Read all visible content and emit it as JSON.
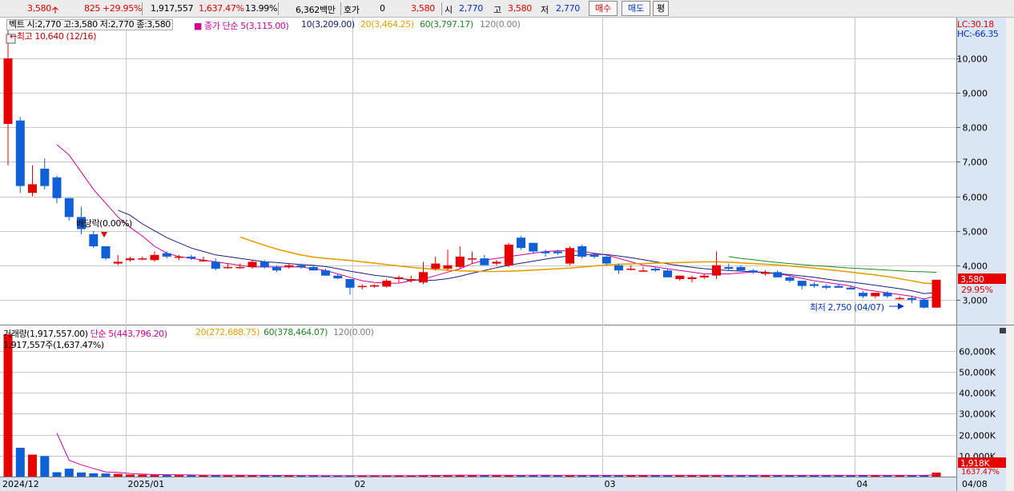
{
  "toolbar": {
    "price": "3,580",
    "change": "825",
    "change_pct": "+29.95%",
    "volume": "1,917,557",
    "volume_pct": "1,637.47%",
    "turnover": "13.99%",
    "amount": "6,362백만",
    "quote_label": "호가",
    "quote_value": "0",
    "quote_price": "3,580",
    "open_label": "시",
    "open": "2,770",
    "high_label": "고",
    "high": "3,580",
    "low_label": "저",
    "low": "2,770",
    "buy_label": "매수",
    "sell_label": "매도",
    "avg_label": "평"
  },
  "colors": {
    "up": "#e60000",
    "down": "#0f5fd6",
    "ma5": "#d1009a",
    "ma10": "#18207f",
    "ma20": "#e8a000",
    "ma60": "#1e8a1e",
    "panel_bg": "#dbe6f4",
    "grid": "#c8c8c8"
  },
  "price_legend": {
    "vtext": "벡트 시:2,770 고:3,580 저:2,770 종:3,580",
    "ma_title": "종가 단순",
    "ma5": "5(3,115.00)",
    "ma10": "10(3,209.00)",
    "ma20": "20(3,464.25)",
    "ma60": "60(3,797.17)",
    "ma120": "120(0.00)"
  },
  "volume_legend": {
    "title": "거래량(1,917,557.00)",
    "ma_title": "단순",
    "ma5": "5(443,796.20)",
    "ma20": "20(272,688.75)",
    "ma60": "60(378,464.07)",
    "ma120": "120(0.00)",
    "sub": "1,917,557주(1,637.47%)"
  },
  "annotations": {
    "high_marker": "←최고 10,640 (12/16)",
    "low_marker": "최저 2,750 (04/07)",
    "dividend": "배당락(0.00%)",
    "lc": "LC:30.18",
    "hc": "HC:-66.35",
    "price_tag": "3,580",
    "pct_tag": "29.95%",
    "vol_tag": "1,918K",
    "vol_pct_tag": "1637.47%"
  },
  "chart_data": [
    {
      "type": "candlestick",
      "title": "",
      "x_labels": [
        "2024/12",
        "2025/01",
        "02",
        "03",
        "04",
        "04/08"
      ],
      "y_ticks": [
        3000,
        4000,
        5000,
        6000,
        7000,
        8000,
        9000,
        10000
      ],
      "ylim": [
        2300,
        11000
      ],
      "grid": true,
      "candles": [
        {
          "open": 8100,
          "high": 11000,
          "low": 6900,
          "close": 10000
        },
        {
          "open": 8200,
          "high": 8300,
          "low": 6100,
          "close": 6300
        },
        {
          "open": 6100,
          "high": 6900,
          "low": 6000,
          "close": 6350
        },
        {
          "open": 6800,
          "high": 7100,
          "low": 6200,
          "close": 6300
        },
        {
          "open": 6550,
          "high": 6600,
          "low": 5800,
          "close": 5950
        },
        {
          "open": 5950,
          "high": 5950,
          "low": 5300,
          "close": 5400
        },
        {
          "open": 5400,
          "high": 5700,
          "low": 4900,
          "close": 5050
        },
        {
          "open": 4900,
          "high": 5000,
          "low": 4500,
          "close": 4550
        },
        {
          "open": 4550,
          "high": 4550,
          "low": 4150,
          "close": 4200
        },
        {
          "open": 4050,
          "high": 4300,
          "low": 4000,
          "close": 4100
        },
        {
          "open": 4150,
          "high": 4250,
          "low": 4100,
          "close": 4200
        },
        {
          "open": 4200,
          "high": 4250,
          "low": 4150,
          "close": 4200
        },
        {
          "open": 4150,
          "high": 4400,
          "low": 4100,
          "close": 4300
        },
        {
          "open": 4350,
          "high": 4400,
          "low": 4200,
          "close": 4250
        },
        {
          "open": 4250,
          "high": 4300,
          "low": 4150,
          "close": 4250
        },
        {
          "open": 4250,
          "high": 4300,
          "low": 4150,
          "close": 4200
        },
        {
          "open": 4150,
          "high": 4250,
          "low": 4100,
          "close": 4150
        },
        {
          "open": 4100,
          "high": 4200,
          "low": 3850,
          "close": 3900
        },
        {
          "open": 3950,
          "high": 4050,
          "low": 3900,
          "close": 3950
        },
        {
          "open": 3950,
          "high": 4050,
          "low": 3900,
          "close": 3950
        },
        {
          "open": 3950,
          "high": 4150,
          "low": 3900,
          "close": 4100
        },
        {
          "open": 4100,
          "high": 4150,
          "low": 3900,
          "close": 3950
        },
        {
          "open": 3950,
          "high": 4000,
          "low": 3800,
          "close": 3850
        },
        {
          "open": 3950,
          "high": 4050,
          "low": 3900,
          "close": 4000
        },
        {
          "open": 4000,
          "high": 4050,
          "low": 3900,
          "close": 3950
        },
        {
          "open": 3950,
          "high": 4000,
          "low": 3850,
          "close": 3850
        },
        {
          "open": 3850,
          "high": 3900,
          "low": 3700,
          "close": 3700
        },
        {
          "open": 3700,
          "high": 3750,
          "low": 3600,
          "close": 3620
        },
        {
          "open": 3600,
          "high": 3600,
          "low": 3150,
          "close": 3350
        },
        {
          "open": 3370,
          "high": 3450,
          "low": 3300,
          "close": 3400
        },
        {
          "open": 3380,
          "high": 3450,
          "low": 3350,
          "close": 3420
        },
        {
          "open": 3380,
          "high": 3600,
          "low": 3350,
          "close": 3550
        },
        {
          "open": 3600,
          "high": 3700,
          "low": 3500,
          "close": 3650
        },
        {
          "open": 3550,
          "high": 3700,
          "low": 3500,
          "close": 3600
        },
        {
          "open": 3500,
          "high": 4100,
          "low": 3450,
          "close": 3800
        },
        {
          "open": 3900,
          "high": 4250,
          "low": 3850,
          "close": 4050
        },
        {
          "open": 3900,
          "high": 4450,
          "low": 3850,
          "close": 4000
        },
        {
          "open": 3950,
          "high": 4550,
          "low": 3900,
          "close": 4250
        },
        {
          "open": 4200,
          "high": 4400,
          "low": 4050,
          "close": 4200
        },
        {
          "open": 4200,
          "high": 4300,
          "low": 4000,
          "close": 4000
        },
        {
          "open": 4050,
          "high": 4150,
          "low": 4000,
          "close": 4100
        },
        {
          "open": 4000,
          "high": 4650,
          "low": 3950,
          "close": 4600
        },
        {
          "open": 4800,
          "high": 4850,
          "low": 4450,
          "close": 4500
        },
        {
          "open": 4650,
          "high": 4650,
          "low": 4350,
          "close": 4400
        },
        {
          "open": 4400,
          "high": 4450,
          "low": 4250,
          "close": 4350
        },
        {
          "open": 4400,
          "high": 4450,
          "low": 4300,
          "close": 4350
        },
        {
          "open": 4050,
          "high": 4550,
          "low": 4000,
          "close": 4500
        },
        {
          "open": 4550,
          "high": 4600,
          "low": 4200,
          "close": 4250
        },
        {
          "open": 4300,
          "high": 4350,
          "low": 4200,
          "close": 4250
        },
        {
          "open": 4250,
          "high": 4300,
          "low": 4000,
          "close": 4050
        },
        {
          "open": 4000,
          "high": 4050,
          "low": 3750,
          "close": 3850
        },
        {
          "open": 3900,
          "high": 4000,
          "low": 3850,
          "close": 3900
        },
        {
          "open": 3850,
          "high": 3950,
          "low": 3800,
          "close": 3850
        },
        {
          "open": 3900,
          "high": 3950,
          "low": 3800,
          "close": 3850
        },
        {
          "open": 3850,
          "high": 3900,
          "low": 3650,
          "close": 3650
        },
        {
          "open": 3600,
          "high": 3700,
          "low": 3550,
          "close": 3700
        },
        {
          "open": 3600,
          "high": 3700,
          "low": 3500,
          "close": 3650
        },
        {
          "open": 3650,
          "high": 3750,
          "low": 3600,
          "close": 3700
        },
        {
          "open": 3700,
          "high": 4400,
          "low": 3600,
          "close": 4000
        },
        {
          "open": 3950,
          "high": 4050,
          "low": 3850,
          "close": 3900
        },
        {
          "open": 3950,
          "high": 4000,
          "low": 3850,
          "close": 3850
        },
        {
          "open": 3850,
          "high": 3900,
          "low": 3750,
          "close": 3800
        },
        {
          "open": 3750,
          "high": 3850,
          "low": 3700,
          "close": 3800
        },
        {
          "open": 3800,
          "high": 3850,
          "low": 3650,
          "close": 3650
        },
        {
          "open": 3650,
          "high": 3700,
          "low": 3500,
          "close": 3550
        },
        {
          "open": 3550,
          "high": 3550,
          "low": 3300,
          "close": 3400
        },
        {
          "open": 3450,
          "high": 3500,
          "low": 3350,
          "close": 3400
        },
        {
          "open": 3400,
          "high": 3450,
          "low": 3300,
          "close": 3350
        },
        {
          "open": 3400,
          "high": 3450,
          "low": 3350,
          "close": 3350
        },
        {
          "open": 3350,
          "high": 3400,
          "low": 3300,
          "close": 3300
        },
        {
          "open": 3200,
          "high": 3250,
          "low": 3050,
          "close": 3100
        },
        {
          "open": 3100,
          "high": 3200,
          "low": 3050,
          "close": 3200
        },
        {
          "open": 3200,
          "high": 3250,
          "low": 3050,
          "close": 3100
        },
        {
          "open": 3050,
          "high": 3100,
          "low": 3000,
          "close": 3050
        },
        {
          "open": 3050,
          "high": 3100,
          "low": 2900,
          "close": 3000
        },
        {
          "open": 3000,
          "high": 3050,
          "low": 2750,
          "close": 2770
        },
        {
          "open": 2770,
          "high": 3580,
          "low": 2770,
          "close": 3580
        }
      ],
      "moving_averages": [
        {
          "name": "5",
          "values": [
            null,
            null,
            null,
            null,
            7500,
            7200,
            6700,
            6200,
            5800,
            5400,
            5100,
            4850,
            4550,
            4350,
            4250,
            4200,
            4150,
            4100,
            4050,
            4000,
            3950,
            3950,
            3950,
            3950,
            3950,
            3900,
            3850,
            3750,
            3650,
            3550,
            3500,
            3480,
            3480,
            3550,
            3600,
            3700,
            3800,
            3900,
            4050,
            4150,
            4200,
            4250,
            4300,
            4350,
            4400,
            4420,
            4420,
            4400,
            4350,
            4300,
            4200,
            4100,
            4000,
            3950,
            3900,
            3850,
            3800,
            3750,
            3750,
            3750,
            3780,
            3800,
            3800,
            3750,
            3700,
            3620,
            3550,
            3500,
            3450,
            3400,
            3300,
            3250,
            3200,
            3150,
            3100,
            3020,
            3115
          ]
        },
        {
          "name": "10",
          "values": [
            null,
            null,
            null,
            null,
            null,
            null,
            null,
            null,
            null,
            5600,
            5450,
            5200,
            5000,
            4800,
            4650,
            4500,
            4400,
            4300,
            4250,
            4200,
            4150,
            4100,
            4080,
            4050,
            4020,
            4000,
            3960,
            3900,
            3830,
            3770,
            3710,
            3670,
            3620,
            3580,
            3560,
            3570,
            3610,
            3680,
            3770,
            3850,
            3930,
            4000,
            4060,
            4120,
            4180,
            4230,
            4270,
            4300,
            4320,
            4310,
            4270,
            4220,
            4160,
            4100,
            4040,
            3990,
            3940,
            3900,
            3870,
            3850,
            3830,
            3810,
            3790,
            3760,
            3730,
            3690,
            3650,
            3600,
            3550,
            3510,
            3470,
            3420,
            3370,
            3320,
            3260,
            3180,
            3209
          ]
        },
        {
          "name": "20",
          "values": [
            null,
            null,
            null,
            null,
            null,
            null,
            null,
            null,
            null,
            null,
            null,
            null,
            null,
            null,
            null,
            null,
            null,
            null,
            null,
            4820,
            4700,
            4580,
            4470,
            4380,
            4300,
            4240,
            4200,
            4170,
            4140,
            4100,
            4060,
            4020,
            3980,
            3940,
            3910,
            3880,
            3860,
            3840,
            3830,
            3820,
            3820,
            3830,
            3840,
            3860,
            3880,
            3900,
            3920,
            3950,
            3980,
            4010,
            4030,
            4040,
            4050,
            4060,
            4070,
            4080,
            4090,
            4100,
            4100,
            4090,
            4070,
            4050,
            4030,
            4010,
            3980,
            3950,
            3920,
            3880,
            3840,
            3800,
            3760,
            3720,
            3670,
            3610,
            3550,
            3480,
            3464
          ]
        },
        {
          "name": "60",
          "values": [
            null,
            null,
            null,
            null,
            null,
            null,
            null,
            null,
            null,
            null,
            null,
            null,
            null,
            null,
            null,
            null,
            null,
            null,
            null,
            null,
            null,
            null,
            null,
            null,
            null,
            null,
            null,
            null,
            null,
            null,
            null,
            null,
            null,
            null,
            null,
            null,
            null,
            null,
            null,
            null,
            null,
            null,
            null,
            null,
            null,
            null,
            null,
            null,
            null,
            null,
            null,
            null,
            null,
            null,
            null,
            null,
            null,
            null,
            null,
            4250,
            4200,
            4160,
            4120,
            4080,
            4050,
            4020,
            3990,
            3970,
            3940,
            3920,
            3900,
            3880,
            3860,
            3840,
            3820,
            3810,
            3797
          ]
        },
        {
          "name": "120",
          "values": []
        }
      ]
    },
    {
      "type": "bar",
      "title": "",
      "y_ticks_labels": [
        "10,000K",
        "20,000K",
        "30,000K",
        "40,000K",
        "50,000K",
        "60,000K"
      ],
      "y_ticks": [
        10000,
        20000,
        30000,
        40000,
        50000,
        60000
      ],
      "ylim": [
        0,
        68000
      ],
      "unit": "K",
      "values": [
        68000,
        13800,
        10500,
        9800,
        2100,
        3800,
        2000,
        1600,
        1500,
        1300,
        1000,
        900,
        800,
        900,
        800,
        700,
        600,
        600,
        700,
        700,
        600,
        600,
        500,
        500,
        500,
        500,
        500,
        500,
        500,
        500,
        500,
        500,
        500,
        500,
        600,
        700,
        700,
        700,
        600,
        600,
        600,
        600,
        700,
        700,
        600,
        600,
        600,
        600,
        600,
        600,
        600,
        600,
        600,
        600,
        600,
        600,
        600,
        600,
        600,
        600,
        600,
        600,
        600,
        600,
        600,
        600,
        600,
        600,
        600,
        600,
        600,
        600,
        600,
        600,
        600,
        700,
        1918
      ],
      "ma5": [
        null,
        null,
        null,
        null,
        20800,
        7800,
        5600,
        3900,
        2200,
        2000,
        1500,
        1200,
        1000,
        900,
        850,
        800,
        700,
        650,
        650,
        650,
        600,
        600,
        570,
        560,
        550,
        520,
        500,
        500,
        500,
        500,
        500,
        500,
        500,
        500,
        520,
        560,
        600,
        640,
        660,
        660,
        650,
        620,
        620,
        640,
        640,
        630,
        620,
        600,
        600,
        600,
        600,
        600,
        600,
        600,
        600,
        600,
        600,
        600,
        600,
        600,
        600,
        600,
        600,
        600,
        600,
        600,
        600,
        600,
        600,
        600,
        600,
        600,
        600,
        600,
        600,
        620,
        800
      ]
    }
  ]
}
